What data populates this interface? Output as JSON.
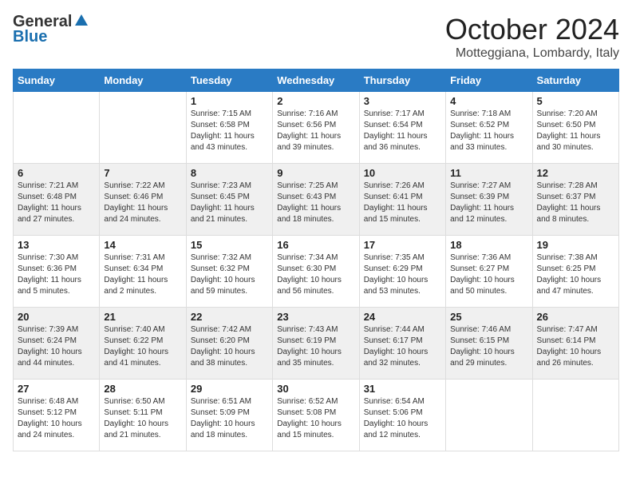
{
  "header": {
    "logo_general": "General",
    "logo_blue": "Blue",
    "month": "October 2024",
    "location": "Motteggiana, Lombardy, Italy"
  },
  "weekdays": [
    "Sunday",
    "Monday",
    "Tuesday",
    "Wednesday",
    "Thursday",
    "Friday",
    "Saturday"
  ],
  "weeks": [
    [
      {
        "day": "",
        "detail": ""
      },
      {
        "day": "",
        "detail": ""
      },
      {
        "day": "1",
        "detail": "Sunrise: 7:15 AM\nSunset: 6:58 PM\nDaylight: 11 hours and 43 minutes."
      },
      {
        "day": "2",
        "detail": "Sunrise: 7:16 AM\nSunset: 6:56 PM\nDaylight: 11 hours and 39 minutes."
      },
      {
        "day": "3",
        "detail": "Sunrise: 7:17 AM\nSunset: 6:54 PM\nDaylight: 11 hours and 36 minutes."
      },
      {
        "day": "4",
        "detail": "Sunrise: 7:18 AM\nSunset: 6:52 PM\nDaylight: 11 hours and 33 minutes."
      },
      {
        "day": "5",
        "detail": "Sunrise: 7:20 AM\nSunset: 6:50 PM\nDaylight: 11 hours and 30 minutes."
      }
    ],
    [
      {
        "day": "6",
        "detail": "Sunrise: 7:21 AM\nSunset: 6:48 PM\nDaylight: 11 hours and 27 minutes."
      },
      {
        "day": "7",
        "detail": "Sunrise: 7:22 AM\nSunset: 6:46 PM\nDaylight: 11 hours and 24 minutes."
      },
      {
        "day": "8",
        "detail": "Sunrise: 7:23 AM\nSunset: 6:45 PM\nDaylight: 11 hours and 21 minutes."
      },
      {
        "day": "9",
        "detail": "Sunrise: 7:25 AM\nSunset: 6:43 PM\nDaylight: 11 hours and 18 minutes."
      },
      {
        "day": "10",
        "detail": "Sunrise: 7:26 AM\nSunset: 6:41 PM\nDaylight: 11 hours and 15 minutes."
      },
      {
        "day": "11",
        "detail": "Sunrise: 7:27 AM\nSunset: 6:39 PM\nDaylight: 11 hours and 12 minutes."
      },
      {
        "day": "12",
        "detail": "Sunrise: 7:28 AM\nSunset: 6:37 PM\nDaylight: 11 hours and 8 minutes."
      }
    ],
    [
      {
        "day": "13",
        "detail": "Sunrise: 7:30 AM\nSunset: 6:36 PM\nDaylight: 11 hours and 5 minutes."
      },
      {
        "day": "14",
        "detail": "Sunrise: 7:31 AM\nSunset: 6:34 PM\nDaylight: 11 hours and 2 minutes."
      },
      {
        "day": "15",
        "detail": "Sunrise: 7:32 AM\nSunset: 6:32 PM\nDaylight: 10 hours and 59 minutes."
      },
      {
        "day": "16",
        "detail": "Sunrise: 7:34 AM\nSunset: 6:30 PM\nDaylight: 10 hours and 56 minutes."
      },
      {
        "day": "17",
        "detail": "Sunrise: 7:35 AM\nSunset: 6:29 PM\nDaylight: 10 hours and 53 minutes."
      },
      {
        "day": "18",
        "detail": "Sunrise: 7:36 AM\nSunset: 6:27 PM\nDaylight: 10 hours and 50 minutes."
      },
      {
        "day": "19",
        "detail": "Sunrise: 7:38 AM\nSunset: 6:25 PM\nDaylight: 10 hours and 47 minutes."
      }
    ],
    [
      {
        "day": "20",
        "detail": "Sunrise: 7:39 AM\nSunset: 6:24 PM\nDaylight: 10 hours and 44 minutes."
      },
      {
        "day": "21",
        "detail": "Sunrise: 7:40 AM\nSunset: 6:22 PM\nDaylight: 10 hours and 41 minutes."
      },
      {
        "day": "22",
        "detail": "Sunrise: 7:42 AM\nSunset: 6:20 PM\nDaylight: 10 hours and 38 minutes."
      },
      {
        "day": "23",
        "detail": "Sunrise: 7:43 AM\nSunset: 6:19 PM\nDaylight: 10 hours and 35 minutes."
      },
      {
        "day": "24",
        "detail": "Sunrise: 7:44 AM\nSunset: 6:17 PM\nDaylight: 10 hours and 32 minutes."
      },
      {
        "day": "25",
        "detail": "Sunrise: 7:46 AM\nSunset: 6:15 PM\nDaylight: 10 hours and 29 minutes."
      },
      {
        "day": "26",
        "detail": "Sunrise: 7:47 AM\nSunset: 6:14 PM\nDaylight: 10 hours and 26 minutes."
      }
    ],
    [
      {
        "day": "27",
        "detail": "Sunrise: 6:48 AM\nSunset: 5:12 PM\nDaylight: 10 hours and 24 minutes."
      },
      {
        "day": "28",
        "detail": "Sunrise: 6:50 AM\nSunset: 5:11 PM\nDaylight: 10 hours and 21 minutes."
      },
      {
        "day": "29",
        "detail": "Sunrise: 6:51 AM\nSunset: 5:09 PM\nDaylight: 10 hours and 18 minutes."
      },
      {
        "day": "30",
        "detail": "Sunrise: 6:52 AM\nSunset: 5:08 PM\nDaylight: 10 hours and 15 minutes."
      },
      {
        "day": "31",
        "detail": "Sunrise: 6:54 AM\nSunset: 5:06 PM\nDaylight: 10 hours and 12 minutes."
      },
      {
        "day": "",
        "detail": ""
      },
      {
        "day": "",
        "detail": ""
      }
    ]
  ]
}
